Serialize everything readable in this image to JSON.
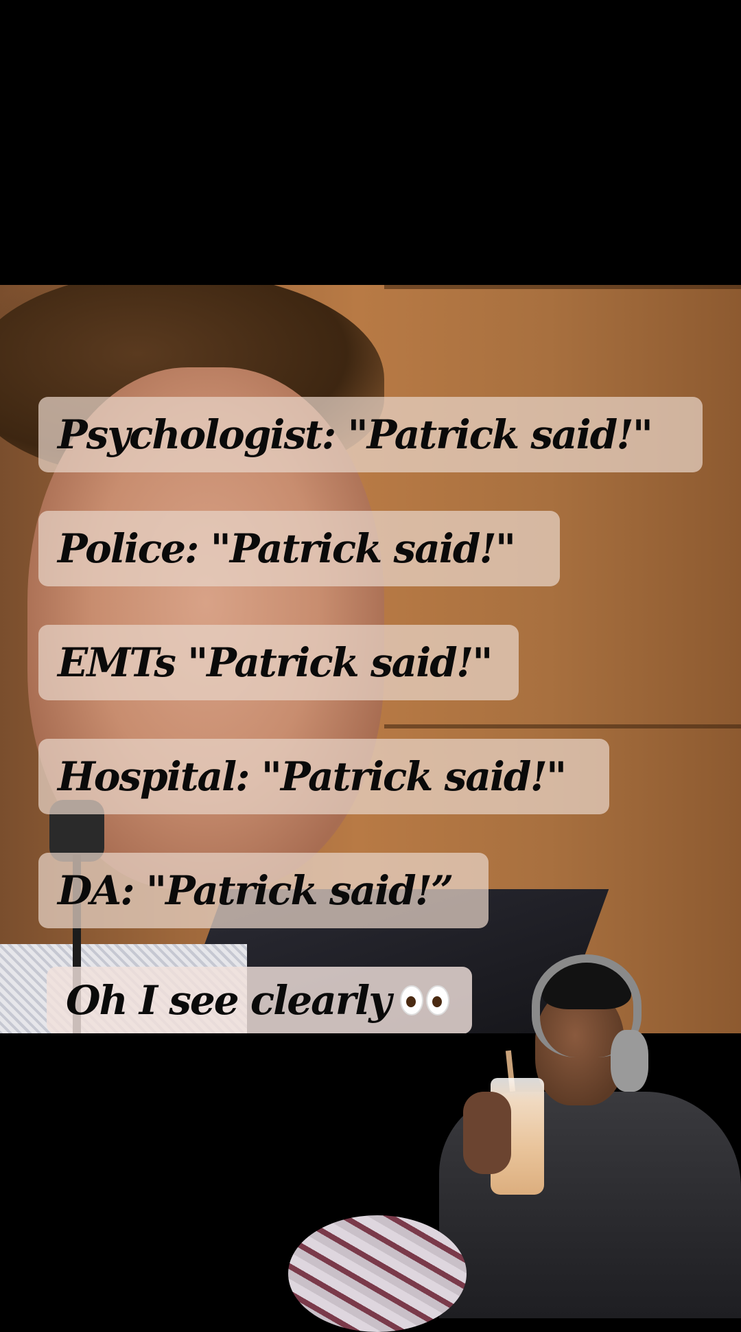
{
  "captions": [
    {
      "text": "Psychologist: \"Patrick said!\""
    },
    {
      "text": "Police: \"Patrick said!\""
    },
    {
      "text": "EMTs \"Patrick said!\""
    },
    {
      "text": "Hospital: \"Patrick said!\""
    },
    {
      "text": "DA: \"Patrick said!”"
    },
    {
      "text": "Oh I see clearly",
      "emoji": "eyes-emoji"
    }
  ]
}
